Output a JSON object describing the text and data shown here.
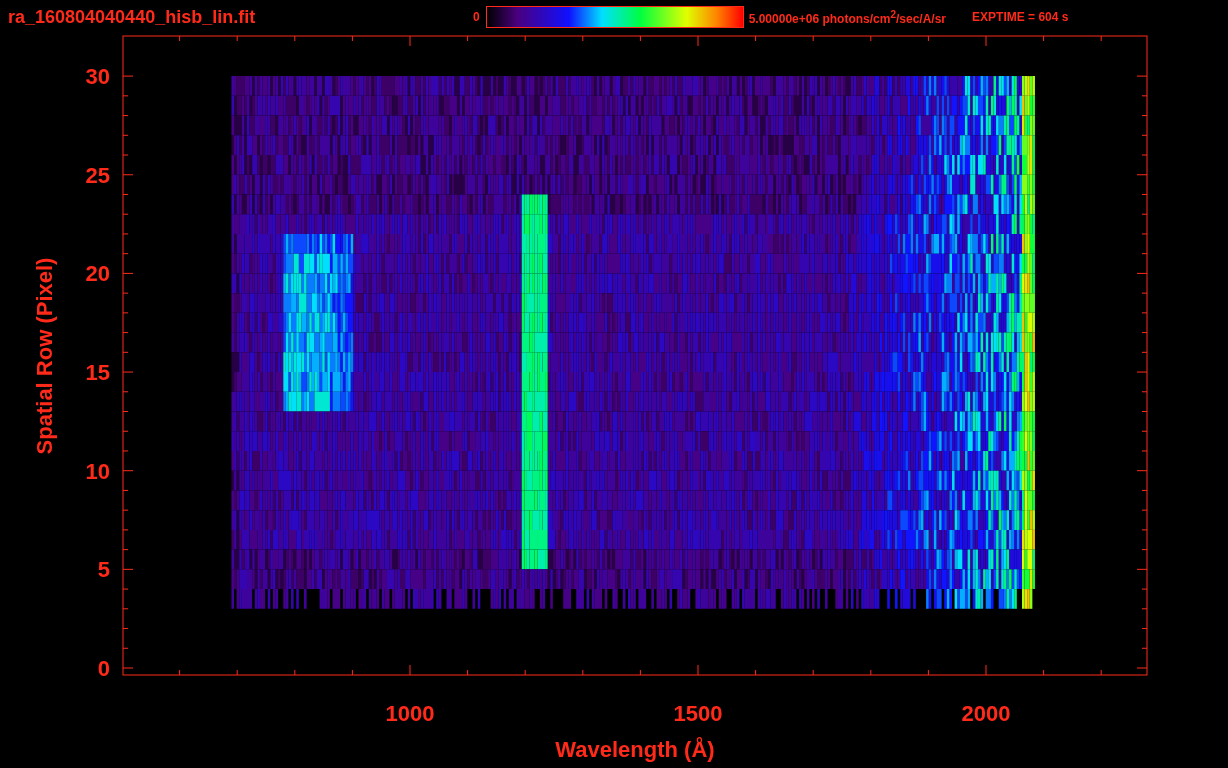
{
  "title": "ra_160804040440_hisb_lin.fit",
  "colorbar": {
    "min_label": "0",
    "max_label": "5.00000e+06 photons/cm$^{2}$/sec/A/sr"
  },
  "exposure": "EXPTIME = 604 s",
  "plot": {
    "xlabel": "Wavelength (Å)",
    "ylabel": "Spatial Row (Pixel)",
    "xticks": [
      "1000",
      "1500",
      "2000"
    ],
    "yticks": [
      "30",
      "25",
      "20",
      "15",
      "10",
      "5",
      "0"
    ]
  }
}
